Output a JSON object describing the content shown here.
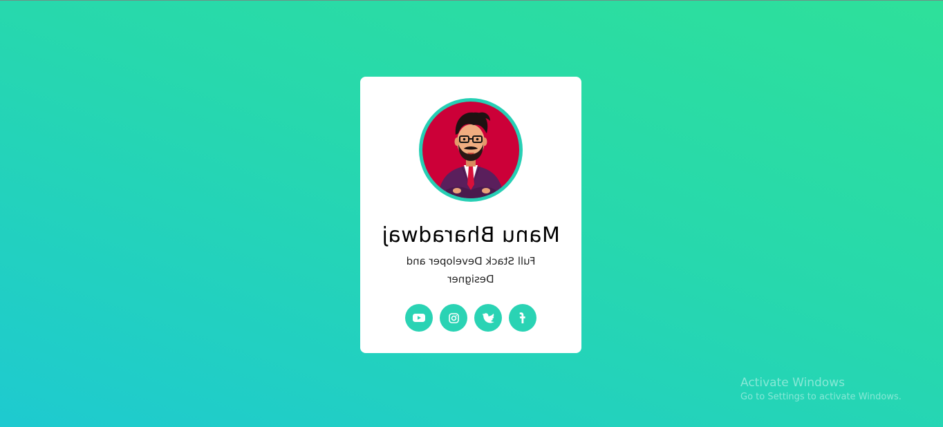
{
  "profile": {
    "name": "Manu Bharadwaj",
    "subtitle_line1": "Full Stack Developer and",
    "subtitle_line2": "Designer"
  },
  "socials": [
    {
      "icon": "youtube-icon"
    },
    {
      "icon": "instagram-icon"
    },
    {
      "icon": "twitter-icon"
    },
    {
      "icon": "facebook-icon"
    }
  ],
  "watermark": {
    "title": "Activate Windows",
    "subtitle": "Go to Settings to activate Windows."
  },
  "colors": {
    "accent": "#2ad3b4",
    "avatar_background": "#cc0038",
    "card": "#ffffff"
  }
}
